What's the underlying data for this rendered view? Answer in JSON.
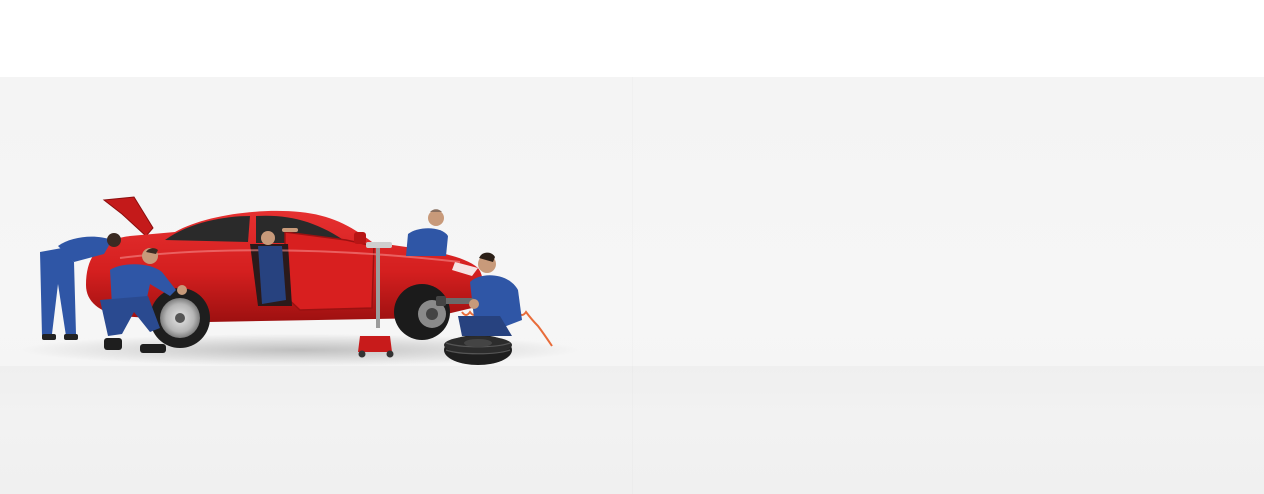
{
  "scene": {
    "subject": "red-car-service-illustration",
    "colors": {
      "car_red": "#d41f1f",
      "car_red_dark": "#9d1010",
      "uniform_blue": "#2f56a6",
      "tire_dark": "#1e1e1e",
      "rim_silver": "#bdbdbd",
      "background": "#f5f5f5",
      "jack_red": "#c81b1b",
      "coil_orange": "#e86c3a"
    }
  }
}
